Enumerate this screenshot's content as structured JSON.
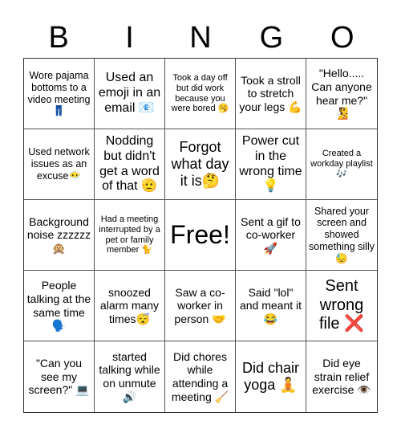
{
  "header": {
    "letters": [
      "B",
      "I",
      "N",
      "G",
      "O"
    ]
  },
  "cells": [
    {
      "text": "Wore pajama bottoms to a video meeting 👖",
      "size": "s-s"
    },
    {
      "text": "Used an emoji in an email 📧",
      "size": "s-l"
    },
    {
      "text": "Took a day off but did work because you were bored 🥱",
      "size": "s-xs"
    },
    {
      "text": "Took a stroll to stretch your legs 💪",
      "size": "s-m"
    },
    {
      "text": "\"Hello..... Can anyone hear me?\" 🧏",
      "size": "s-m"
    },
    {
      "text": "Used network issues as an excuse😶‍🌫️",
      "size": "s-s"
    },
    {
      "text": "Nodding but didn't get a word of that 🫡",
      "size": "s-l"
    },
    {
      "text": "Forgot what day it is🤔",
      "size": "s-xl"
    },
    {
      "text": "Power cut in the wrong time💡",
      "size": "s-l"
    },
    {
      "text": "Created a workday playlist 🎶",
      "size": "s-xs"
    },
    {
      "text": "Background noise zzzzzz 🙊",
      "size": "s-m"
    },
    {
      "text": "Had a meeting interrupted by a pet or family member 🐈",
      "size": "s-xs"
    },
    {
      "text": "Free!",
      "size": "s-free"
    },
    {
      "text": "Sent a gif to co-worker 🚀",
      "size": "s-m"
    },
    {
      "text": "Shared your screen and showed something silly 😓",
      "size": "s-s"
    },
    {
      "text": "People talking at the same time 🗣️",
      "size": "s-m"
    },
    {
      "text": "snoozed alarm many times😴",
      "size": "s-m"
    },
    {
      "text": "Saw a co-worker in person 🤝",
      "size": "s-m"
    },
    {
      "text": "Said \"lol\" and meant it 😂",
      "size": "s-m"
    },
    {
      "text": "Sent wrong file ❌",
      "size": "s-xxl"
    },
    {
      "text": "\"Can you see my screen?\" 💻",
      "size": "s-m"
    },
    {
      "text": "started talking while on unmute🔊",
      "size": "s-m"
    },
    {
      "text": "Did chores while attending a meeting 🧹",
      "size": "s-m"
    },
    {
      "text": "Did chair yoga 🧘",
      "size": "s-xl"
    },
    {
      "text": "Did eye strain relief exercise 👁️",
      "size": "s-m"
    }
  ]
}
